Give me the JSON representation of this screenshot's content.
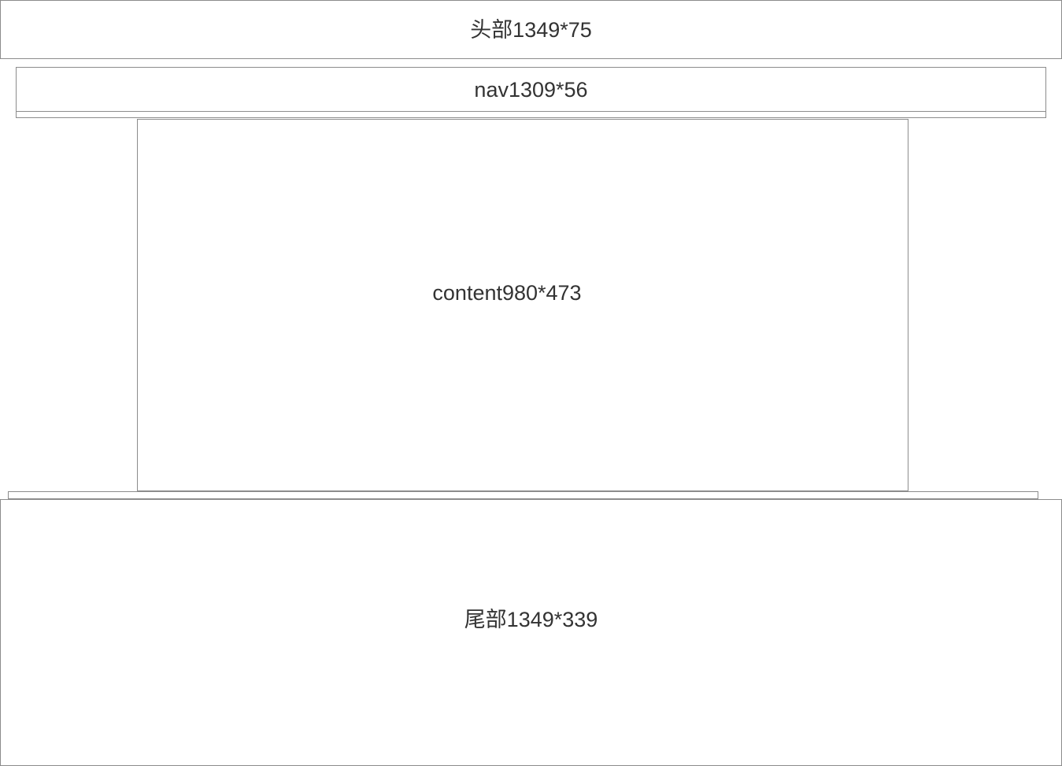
{
  "header": {
    "label": "头部1349*75"
  },
  "nav": {
    "label": "nav1309*56"
  },
  "content": {
    "label": "content980*473"
  },
  "footer": {
    "label": "尾部1349*339"
  }
}
